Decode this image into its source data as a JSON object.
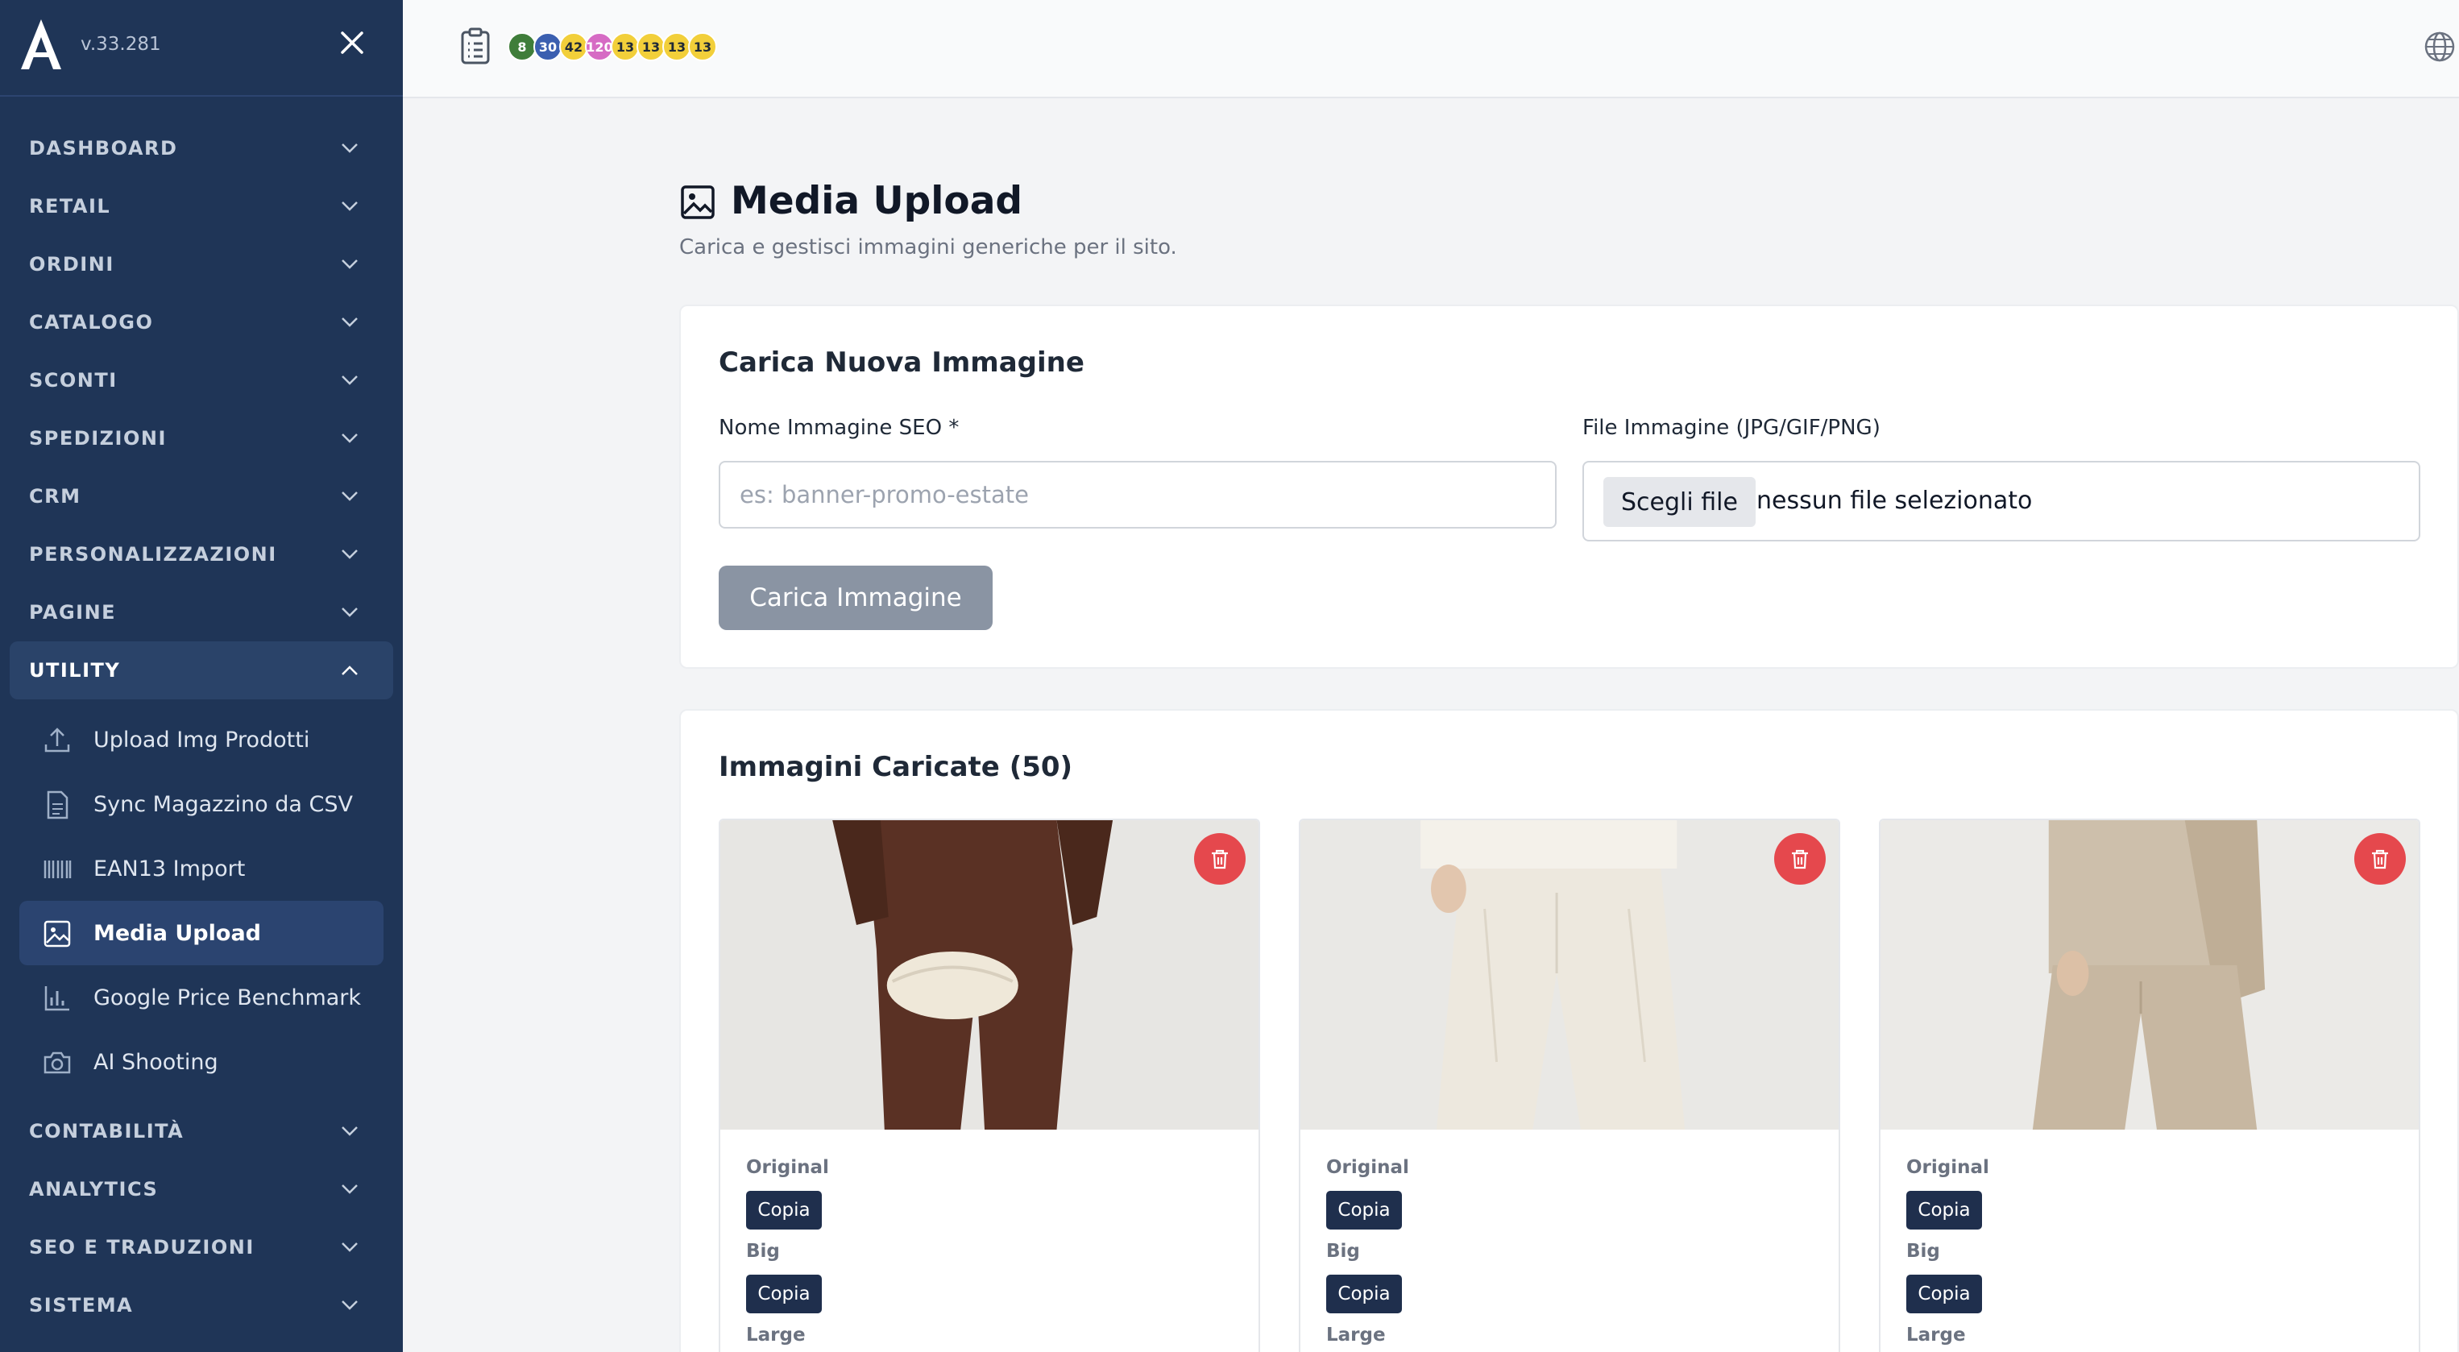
{
  "app": {
    "version": "v.33.281"
  },
  "sidebar": {
    "sections": [
      {
        "label": "DASHBOARD"
      },
      {
        "label": "RETAIL"
      },
      {
        "label": "ORDINI"
      },
      {
        "label": "CATALOGO"
      },
      {
        "label": "SCONTI"
      },
      {
        "label": "SPEDIZIONI"
      },
      {
        "label": "CRM"
      },
      {
        "label": "PERSONALIZZAZIONI"
      },
      {
        "label": "PAGINE"
      }
    ],
    "open_section": {
      "label": "UTILITY",
      "items": [
        {
          "label": "Upload Img Prodotti",
          "icon": "upload-icon"
        },
        {
          "label": "Sync Magazzino da CSV",
          "icon": "csv-file-icon"
        },
        {
          "label": "EAN13 Import",
          "icon": "barcode-icon"
        },
        {
          "label": "Media Upload",
          "icon": "image-icon",
          "active": true
        },
        {
          "label": "Google Price Benchmark",
          "icon": "bar-chart-icon"
        },
        {
          "label": "AI Shooting",
          "icon": "camera-icon"
        }
      ]
    },
    "sections_after": [
      {
        "label": "CONTABILITÀ"
      },
      {
        "label": "ANALYTICS"
      },
      {
        "label": "SEO E TRADUZIONI"
      },
      {
        "label": "SISTEMA"
      }
    ]
  },
  "topbar": {
    "badges": [
      {
        "value": "8",
        "color": "#3f7d3a",
        "text_color": "#ffffff"
      },
      {
        "value": "30",
        "color": "#3b5fb0",
        "text_color": "#ffffff"
      },
      {
        "value": "42",
        "color": "#f2cf3a",
        "text_color": "#1f2937"
      },
      {
        "value": "120",
        "color": "#d66bc4",
        "text_color": "#ffffff"
      },
      {
        "value": "13",
        "color": "#f2cf3a",
        "text_color": "#1f2937"
      },
      {
        "value": "13",
        "color": "#f2cf3a",
        "text_color": "#1f2937"
      },
      {
        "value": "13",
        "color": "#f2cf3a",
        "text_color": "#1f2937"
      },
      {
        "value": "13",
        "color": "#f2cf3a",
        "text_color": "#1f2937"
      }
    ]
  },
  "main": {
    "title": "Media Upload",
    "subtitle": "Carica e gestisci immagini generiche per il sito.",
    "upload_card": {
      "title": "Carica Nuova Immagine",
      "name_label": "Nome Immagine SEO *",
      "name_placeholder": "es: banner-promo-estate",
      "file_label": "File Immagine (JPG/GIF/PNG)",
      "file_button": "Scegli file",
      "file_status": "nessun file selezionato",
      "submit_label": "Carica Immagine"
    },
    "gallery": {
      "title": "Immagini Caricate (50)",
      "images": [
        {
          "alt": "brown trousers with cream clutch",
          "bg": "#e7e6e3",
          "garment": "#5a3124"
        },
        {
          "alt": "cream wide trousers",
          "bg": "#e9e8e5",
          "garment": "#ede8de"
        },
        {
          "alt": "beige suit trousers and vest",
          "bg": "#ebeae7",
          "garment": "#c7b7a1"
        }
      ],
      "size_labels": {
        "original": "Original",
        "big": "Big",
        "large": "Large"
      },
      "copy_label": "Copia"
    }
  }
}
